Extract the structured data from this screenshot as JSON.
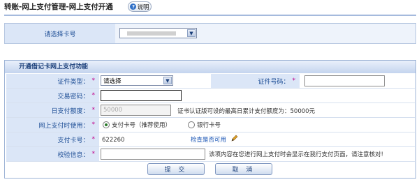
{
  "page": {
    "title": "转账-网上支付管理-网上支付开通",
    "help_label": "说明"
  },
  "card_select": {
    "label": "请选择卡号"
  },
  "section": {
    "title": "开通借记卡网上支付功能"
  },
  "form": {
    "id_type_label": "证件类型：",
    "id_type_value": "请选择",
    "id_number_label": "证件号码：",
    "password_label": "交易密码：",
    "daily_limit_label": "日支付额度：",
    "daily_limit_value": "50000",
    "daily_limit_hint": "证书认证版可设的最高日累计支付额度为：50000元",
    "pay_method_label": "网上支付时使用：",
    "pay_method_options": [
      "支付卡号（推荐使用）",
      "银行卡号"
    ],
    "card_no_label": "支付卡号：",
    "card_no_value": "622260",
    "check_link": "检查是否可用",
    "verify_label": "校验信息：",
    "verify_hint": "该项内容在您进行网上支付时会显示在我行支付页面，请注意核对!",
    "required_mark": "*"
  },
  "buttons": {
    "submit": "提 交",
    "cancel": "取 消"
  },
  "colors": {
    "label_bg": "#dbe6f7",
    "label_text": "#1f4f96",
    "required": "#c0008a",
    "link": "#1a55b5"
  }
}
